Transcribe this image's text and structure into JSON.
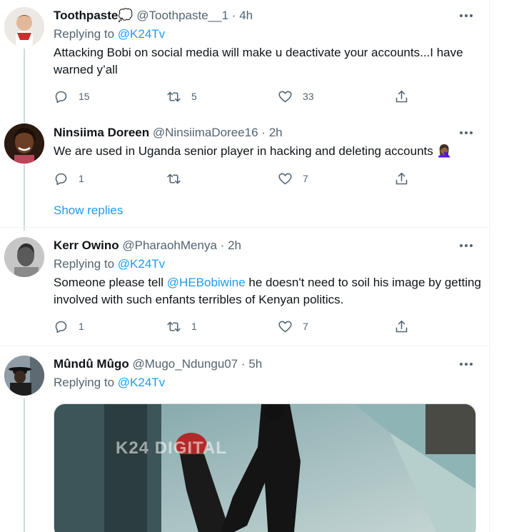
{
  "colors": {
    "link": "#1d9bf0",
    "secondary": "#536471",
    "text": "#0f1419",
    "border": "#eff3f4"
  },
  "tweets": [
    {
      "name": "Toothpaste💭",
      "handle": "@Toothpaste__1",
      "sep": "·",
      "time": "4h",
      "replying_prefix": "Replying to",
      "replying_to": "@K24Tv",
      "text": "Attacking Bobi on social media will make u deactivate your accounts...I have warned y’all",
      "replies": "15",
      "retweets": "5",
      "likes": "33"
    },
    {
      "name": "Ninsiima Doreen",
      "handle": "@NinsiimaDoree16",
      "sep": "·",
      "time": "2h",
      "text": "We are used in Uganda senior player in hacking and deleting accounts 🤦🏾‍♀️",
      "replies": "1",
      "retweets": "",
      "likes": "7"
    },
    {
      "name": "Kerr Owino",
      "handle": "@PharaohMenya",
      "sep": "·",
      "time": "2h",
      "replying_prefix": "Replying to",
      "replying_to": "@K24Tv",
      "text_prefix": "Someone please tell ",
      "mention": "@HEBobiwine",
      "text_suffix": " he doesn't need to soil his image by getting involved with such enfants terribles of Kenyan politics.",
      "replies": "1",
      "retweets": "1",
      "likes": "7"
    },
    {
      "name": "Mûndû Mûgo",
      "handle": "@Mugo_Ndungu07",
      "sep": "·",
      "time": "5h",
      "replying_prefix": "Replying to",
      "replying_to": "@K24Tv",
      "media_watermark": "K24 DIGITAL"
    }
  ],
  "show_replies": "Show replies"
}
